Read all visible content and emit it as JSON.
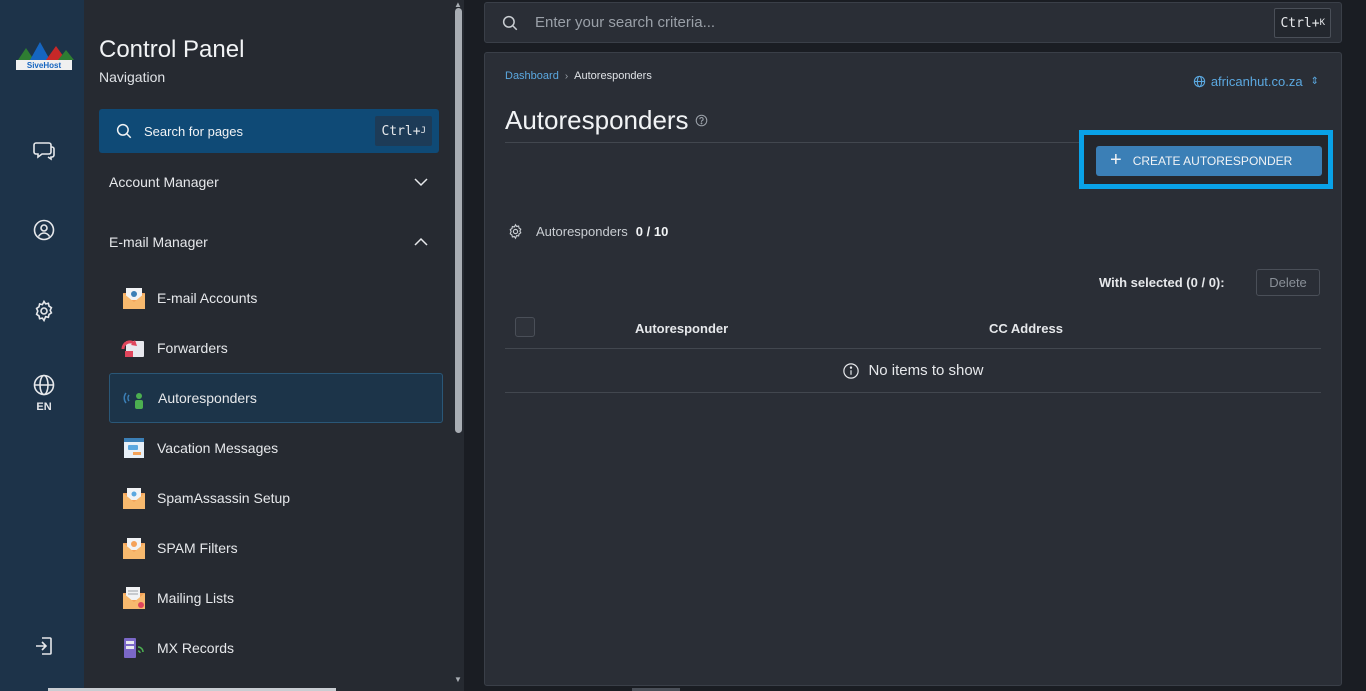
{
  "rail": {
    "language": "EN",
    "logo_text": "SiveHost"
  },
  "nav": {
    "title": "Control Panel",
    "subtitle": "Navigation",
    "search_label": "Search for pages",
    "search_shortcut": "Ctrl+",
    "search_shortcut_key": "J",
    "sections": [
      {
        "label": "Account Manager",
        "expanded": false
      },
      {
        "label": "E-mail Manager",
        "expanded": true
      }
    ],
    "items": [
      {
        "label": "E-mail Accounts",
        "icon": "email-accounts-icon"
      },
      {
        "label": "Forwarders",
        "icon": "forwarders-icon"
      },
      {
        "label": "Autoresponders",
        "icon": "autoresponders-icon",
        "active": true
      },
      {
        "label": "Vacation Messages",
        "icon": "vacation-messages-icon"
      },
      {
        "label": "SpamAssassin Setup",
        "icon": "spamassassin-icon"
      },
      {
        "label": "SPAM Filters",
        "icon": "spam-filters-icon"
      },
      {
        "label": "Mailing Lists",
        "icon": "mailing-lists-icon"
      },
      {
        "label": "MX Records",
        "icon": "mx-records-icon"
      }
    ]
  },
  "topbar": {
    "search_placeholder": "Enter your search criteria...",
    "shortcut": "Ctrl+",
    "shortcut_key": "K"
  },
  "main": {
    "breadcrumb": {
      "root": "Dashboard",
      "current": "Autoresponders"
    },
    "domain": "africanhut.co.za",
    "page_title": "Autoresponders",
    "create_button": "CREATE AUTORESPONDER",
    "counter_label": "Autoresponders",
    "counter_value": "0 / 10",
    "with_selected": "With selected (0 / 0):",
    "delete_button": "Delete",
    "table": {
      "columns": [
        "Autoresponder",
        "CC Address"
      ],
      "empty_text": "No items to show"
    }
  },
  "colors": {
    "accent": "#3b7fb6",
    "highlight_border": "#09a2e8",
    "link": "#5ba8e0",
    "rail_bg": "#1d3349",
    "panel_bg": "#262a31"
  }
}
